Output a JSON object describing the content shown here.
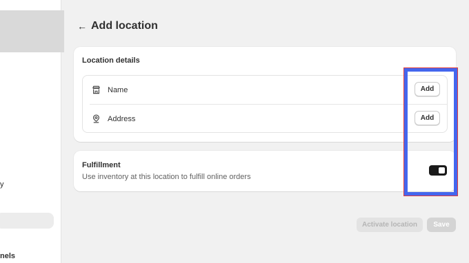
{
  "page": {
    "title": "Add location",
    "back_icon": "←"
  },
  "sidebar": {
    "fragment_1": "y",
    "fragment_2": "nels"
  },
  "location_details": {
    "title": "Location details",
    "rows": [
      {
        "label": "Name",
        "icon": "store-icon",
        "button": "Add"
      },
      {
        "label": "Address",
        "icon": "location-pin-icon",
        "button": "Add"
      }
    ]
  },
  "fulfillment": {
    "title": "Fulfillment",
    "description": "Use inventory at this location to fulfill online orders",
    "toggle_on": true
  },
  "footer": {
    "activate_label": "Activate location",
    "save_label": "Save"
  },
  "colors": {
    "highlight": "#4466ee",
    "toggle": "#1a1a1a",
    "background": "#f1f1f1"
  }
}
